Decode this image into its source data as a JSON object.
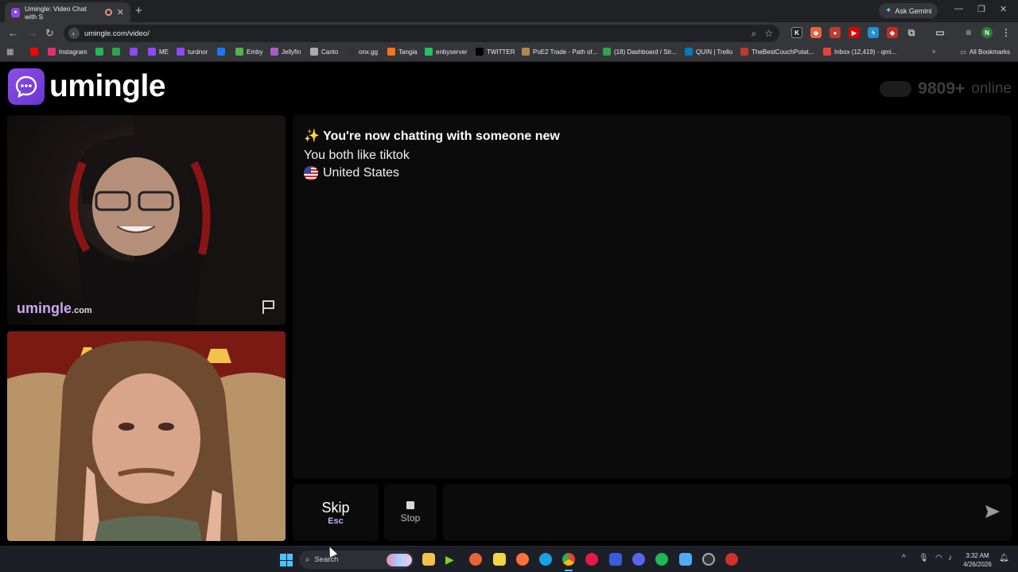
{
  "browser": {
    "tab_title": "Umingle: Video Chat with S",
    "new_tab_icon": "plus-icon",
    "gemini_label": "Ask Gemini",
    "url": "umingle.com/video/",
    "bookmarks": [
      {
        "label": "",
        "color": "#ff0000"
      },
      {
        "label": "Instagram",
        "color": "#e1306c"
      },
      {
        "label": "",
        "color": "#1db954"
      },
      {
        "label": "",
        "color": "#2da44e"
      },
      {
        "label": "",
        "color": "#9146ff"
      },
      {
        "label": "ME",
        "color": "#9146ff"
      },
      {
        "label": "turdnor",
        "color": "#9146ff"
      },
      {
        "label": "",
        "color": "#1877f2"
      },
      {
        "label": "Emby",
        "color": "#52b54b"
      },
      {
        "label": "Jellyfin",
        "color": "#aa5cc3"
      },
      {
        "label": "Canto",
        "color": "#aaaaaa"
      },
      {
        "label": "onx.gg",
        "color": "#333333"
      },
      {
        "label": "Tangia",
        "color": "#f97316"
      },
      {
        "label": "enbyserver",
        "color": "#22c55e"
      },
      {
        "label": "TWITTER",
        "color": "#000000"
      },
      {
        "label": "PoE2 Trade - Path of...",
        "color": "#b08a4a"
      },
      {
        "label": "(18) Dashboard / Str...",
        "color": "#2da44e"
      },
      {
        "label": "QUIN | Trello",
        "color": "#0079bf"
      },
      {
        "label": "TheBestCouchPotat...",
        "color": "#c0392b"
      },
      {
        "label": "Inbox (12,419) - qmi...",
        "color": "#ea4335"
      }
    ],
    "all_bookmarks": "All Bookmarks"
  },
  "site": {
    "logo_text": "umingle",
    "online_count": "9809+",
    "online_label": "online",
    "watermark_main": "umingle",
    "watermark_suffix": ".com",
    "chat": {
      "line1": "✨ You're now chatting with someone new",
      "line2": "You both like tiktok",
      "line3": "United States"
    },
    "skip_label": "Skip",
    "skip_hint": "Esc",
    "stop_label": "Stop",
    "message_placeholder": ""
  },
  "taskbar": {
    "search_label": "Search",
    "time": "3:32 AM",
    "date": "4/26/2026"
  },
  "colors": {
    "brand": "#8a4fe8",
    "accent_text": "#c9a8f5"
  }
}
